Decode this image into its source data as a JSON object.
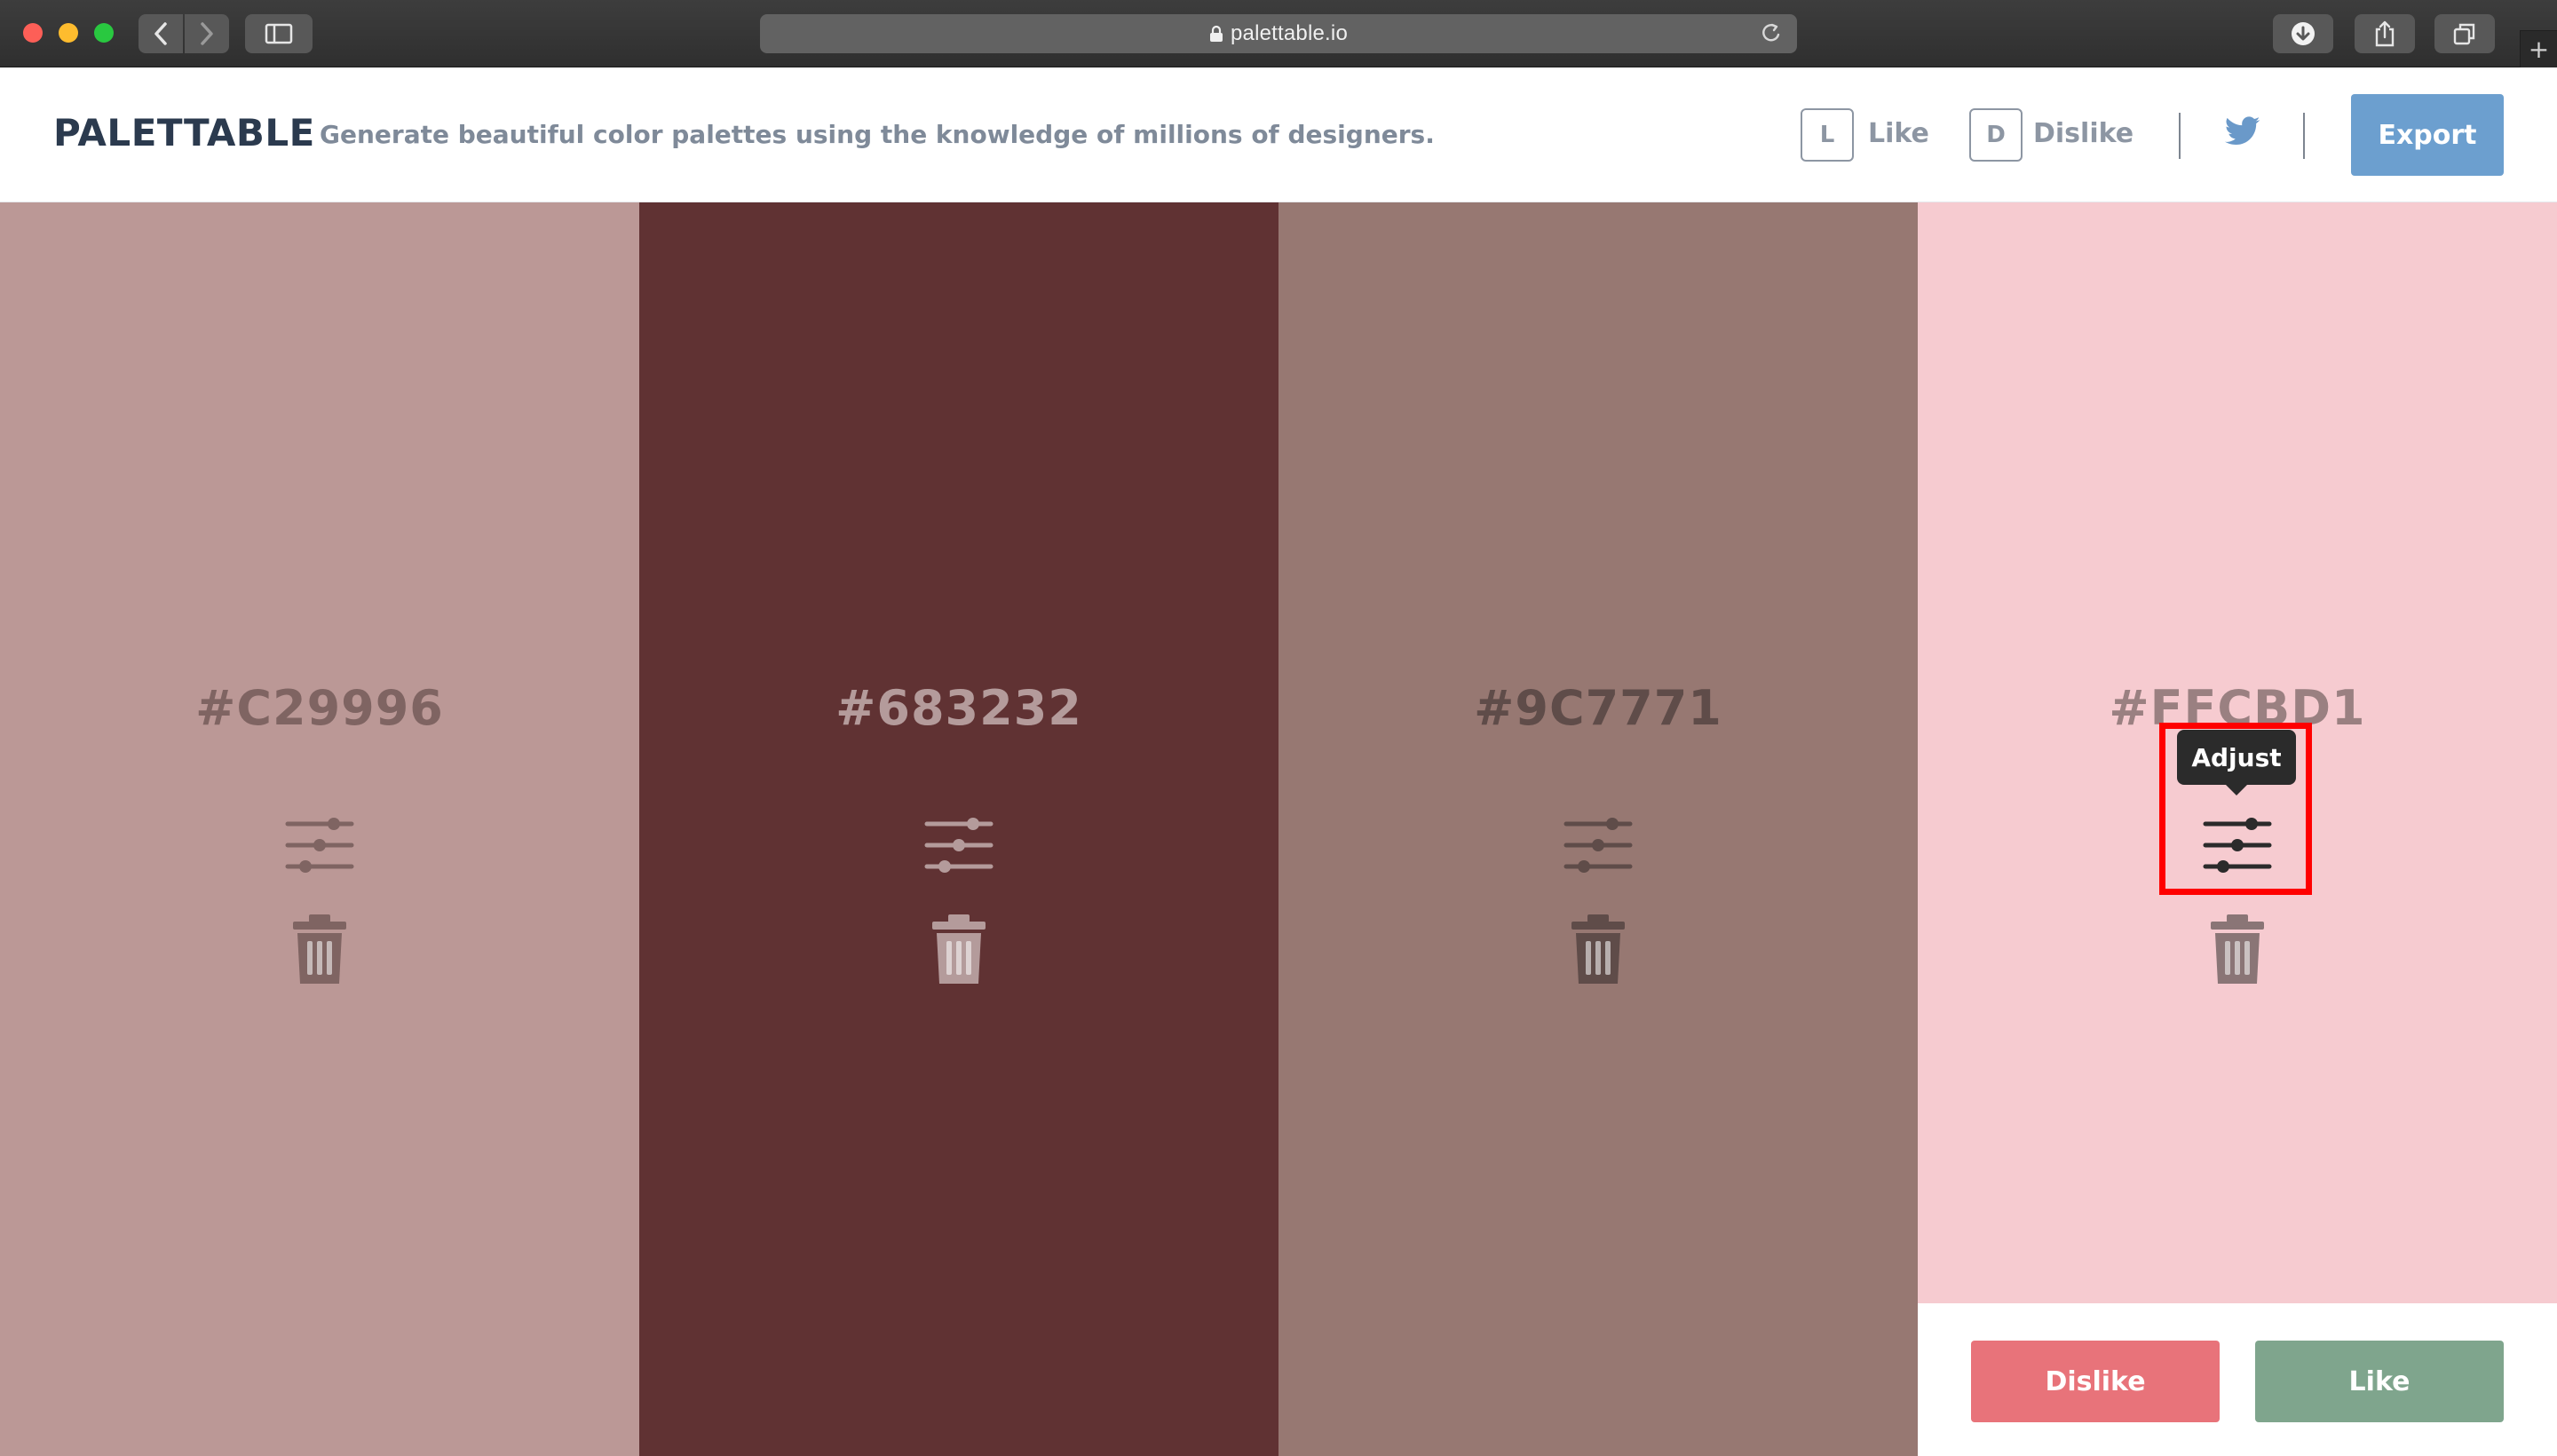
{
  "browser": {
    "url": "palettable.io"
  },
  "header": {
    "logo": "PALETTABLE",
    "tagline": "Generate beautiful color palettes using the knowledge of millions of designers.",
    "like_key": "L",
    "like_label": "Like",
    "dislike_key": "D",
    "dislike_label": "Dislike",
    "export_label": "Export"
  },
  "palette": [
    {
      "hex": "#C29996",
      "color": "#bb9896",
      "text_color": "#7f6462",
      "icon_color": "#7f6462"
    },
    {
      "hex": "#683232",
      "color": "#603233",
      "text_color": "#b49b9b",
      "icon_color": "#b49b9b"
    },
    {
      "hex": "#9C7771",
      "color": "#977872",
      "text_color": "#5f4c49",
      "icon_color": "#5f4c49"
    },
    {
      "hex": "#FFCBD1",
      "color": "#f6cbd0",
      "text_color": "#9a8081",
      "icon_color": "#8a7576"
    }
  ],
  "tooltip": {
    "label": "Adjust"
  },
  "vote": {
    "dislike_label": "Dislike",
    "like_label": "Like"
  },
  "colors": {
    "accent": "#6c9fcf",
    "dislike": "#e8737a",
    "like": "#7fa58d",
    "highlight": "#ff0000"
  }
}
